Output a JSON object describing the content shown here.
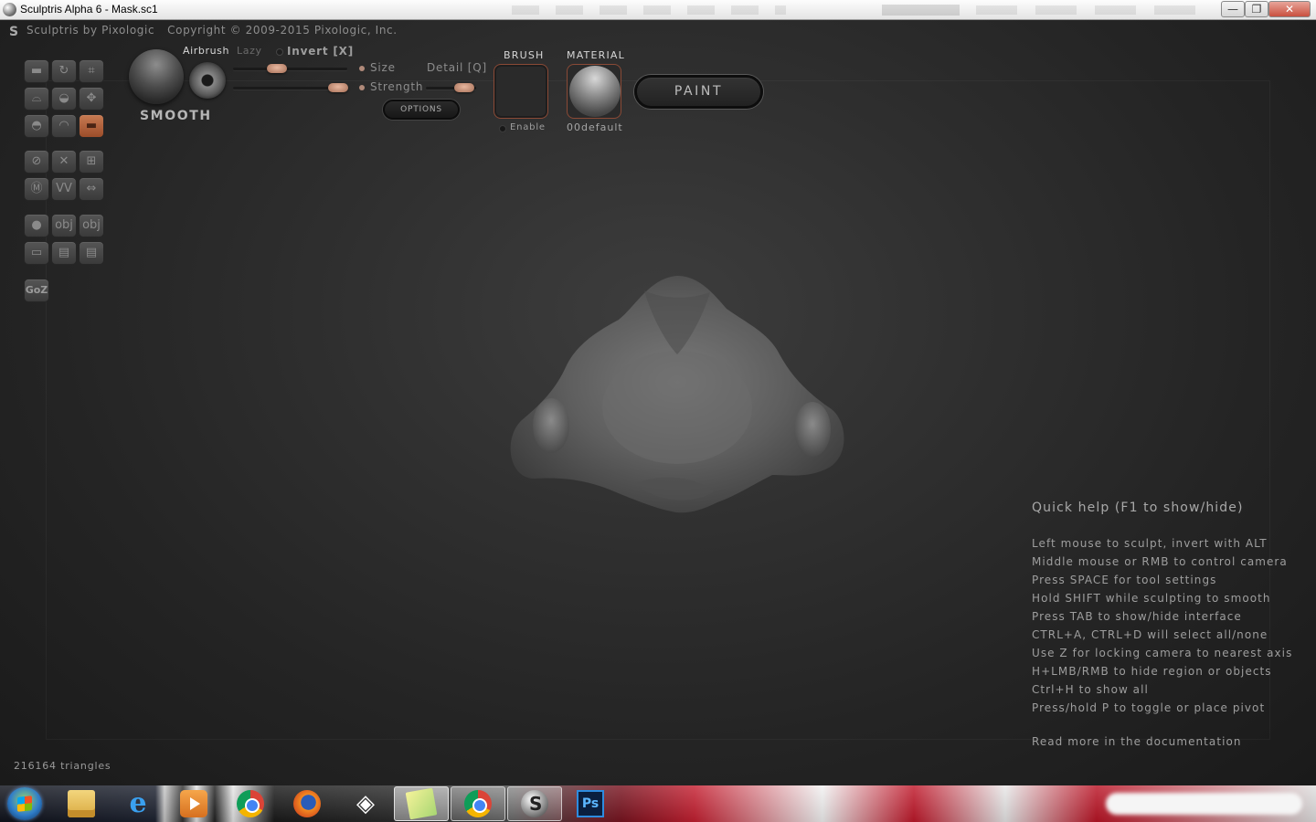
{
  "window": {
    "title": "Sculptris Alpha 6 - Mask.sc1",
    "min_glyph": "—",
    "max_glyph": "❐",
    "close_glyph": "✕"
  },
  "header": {
    "app_name": "Sculptris by Pixologic",
    "copyright": "Copyright © 2009-2015 Pixologic, Inc."
  },
  "brush": {
    "name": "SMOOTH",
    "airbrush_label": "Airbrush",
    "lazy_label": "Lazy",
    "invert_label": "Invert [X]",
    "size_label": "Size",
    "detail_label": "Detail [Q]",
    "strength_label": "Strength",
    "options_label": "OPTIONS"
  },
  "brush_slot": {
    "label": "BRUSH",
    "enable_label": "Enable"
  },
  "material": {
    "label": "MATERIAL",
    "name": "00default"
  },
  "paint_button": "PAINT",
  "tools": {
    "goz_label": "GoZ",
    "active_tool": "flatten"
  },
  "help": {
    "title": "Quick help (F1 to show/hide)",
    "lines": [
      "Left mouse to sculpt, invert with ALT",
      "Middle mouse or RMB to control camera",
      "Press SPACE for tool settings",
      "Hold SHIFT while sculpting to smooth",
      "Press TAB to show/hide interface",
      "CTRL+A, CTRL+D will select all/none",
      "Use Z for locking camera to nearest axis",
      "H+LMB/RMB to hide region or objects",
      "Ctrl+H to show all",
      "Press/hold P to toggle or place pivot"
    ],
    "more": "Read more in the documentation"
  },
  "status": {
    "triangles": "216164 triangles"
  },
  "taskbar": {
    "ie_glyph": "e",
    "unity_glyph": "◈",
    "ps_label": "Ps"
  },
  "colors": {
    "accent": "#b0673f",
    "background": "#2f2f2f"
  }
}
